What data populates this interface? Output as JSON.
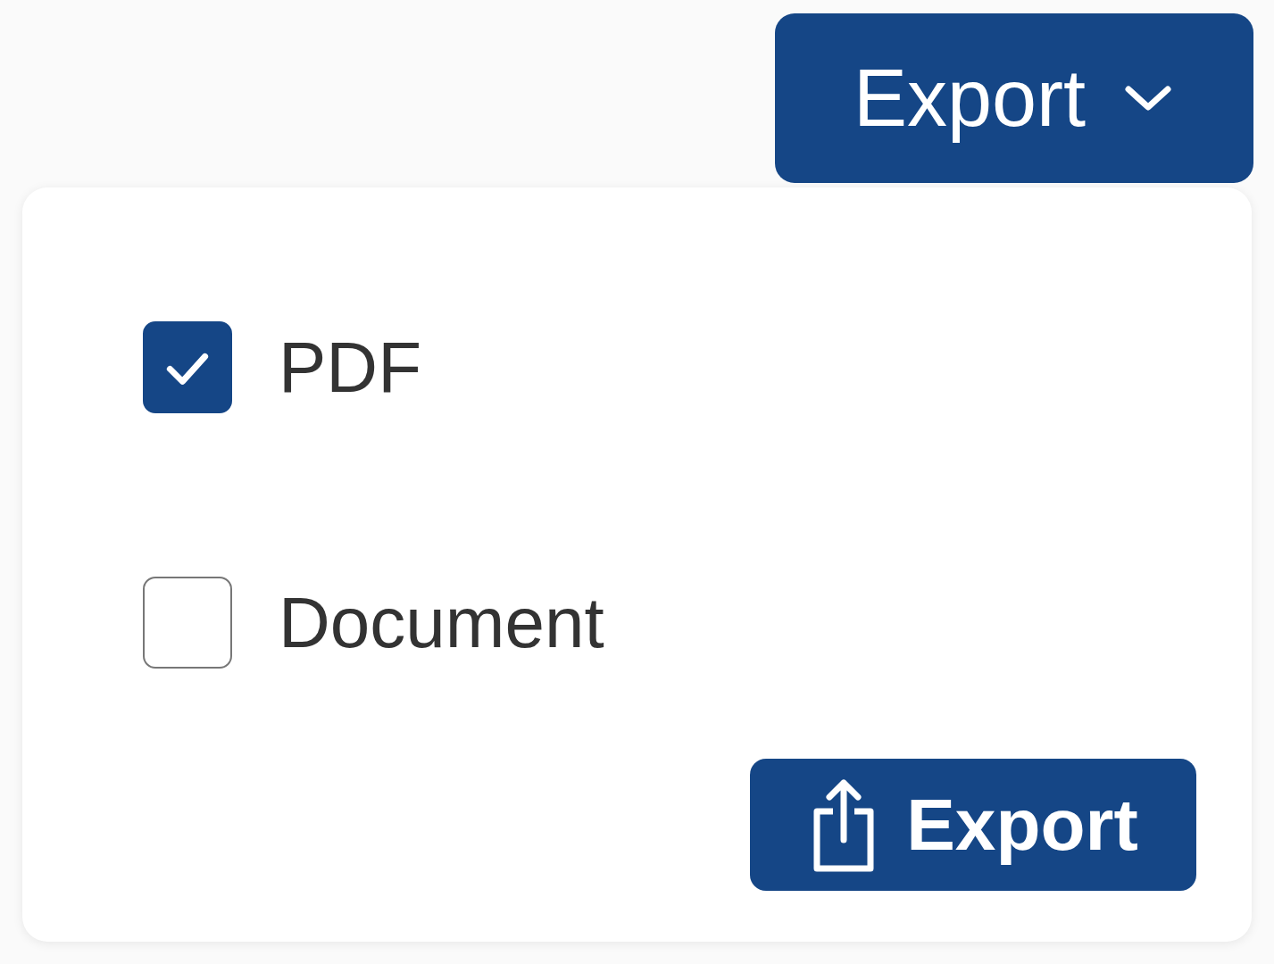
{
  "export_button": {
    "label": "Export"
  },
  "options": [
    {
      "label": "PDF",
      "checked": true
    },
    {
      "label": "Document",
      "checked": false
    }
  ],
  "submit_button": {
    "label": "Export"
  }
}
